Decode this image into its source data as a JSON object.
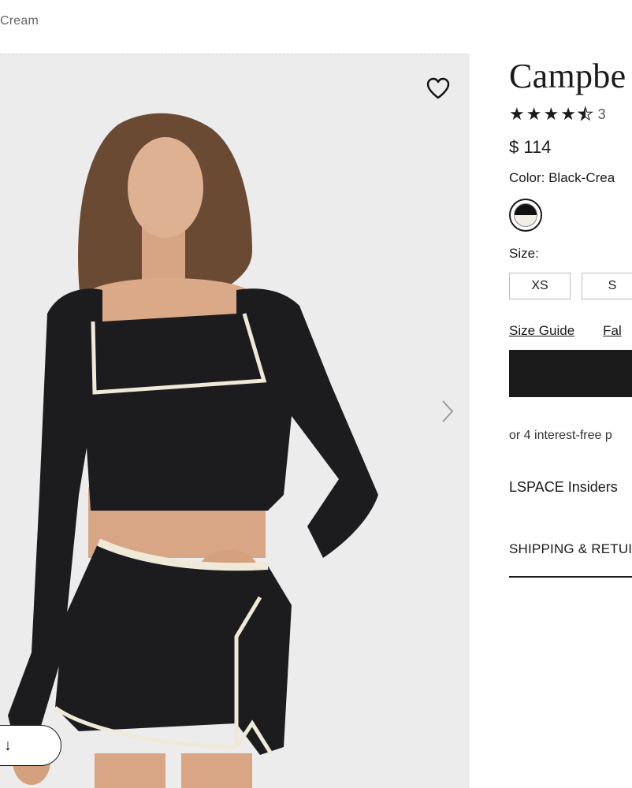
{
  "breadcrumb": {
    "text": "Cream"
  },
  "gallery": {
    "next_icon": "chevron-right-icon",
    "wishlist_icon": "heart-icon",
    "pill_label": "↓"
  },
  "product": {
    "title": "Campbe",
    "rating": {
      "stars_filled": 4.5,
      "stars_total": 5,
      "count_partial": "3"
    },
    "price": "$ 114",
    "color_label": "Color:",
    "color_value": "Black-Crea",
    "swatch_colors": [
      "#111111",
      "#f1efe8"
    ],
    "size_label": "Size:",
    "sizes": [
      "XS",
      "S"
    ],
    "size_guide": "Size Guide",
    "fit_link": "Fal",
    "installments": "or 4 interest-free p",
    "insiders": "LSPACE Insiders",
    "shipping": "SHIPPING & RETUI"
  }
}
